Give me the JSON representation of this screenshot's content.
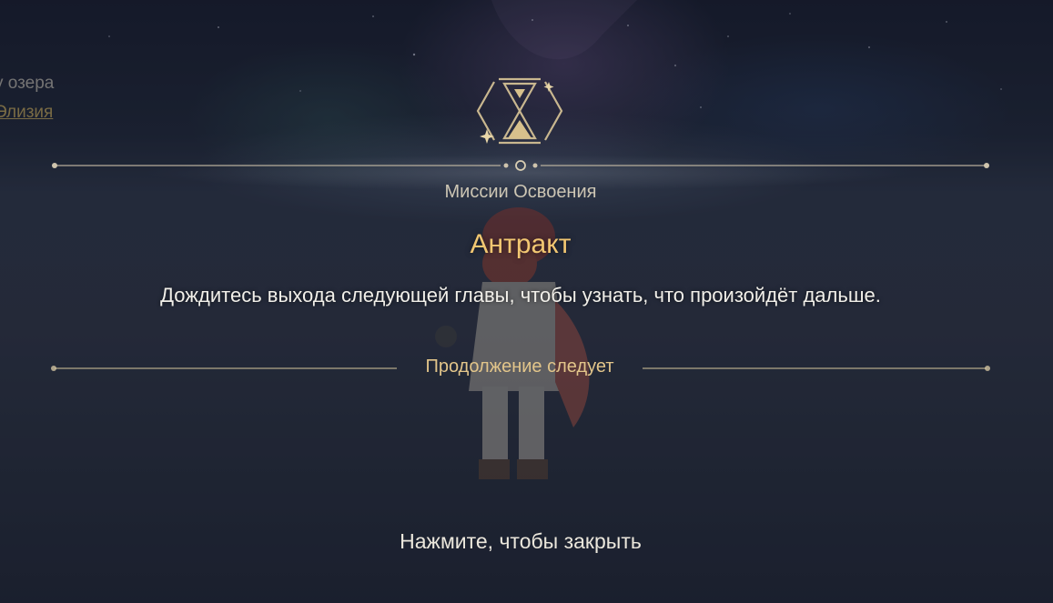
{
  "quest_tracker": {
    "line1": "у озера",
    "line2": "Элизия"
  },
  "dialog": {
    "category": "Миссии Освоения",
    "title": "Антракт",
    "description": "Дождитесь выхода следующей главы, чтобы узнать, что произойдёт дальше.",
    "continue_label": "Продолжение следует",
    "close_hint": "Нажмите, чтобы закрыть"
  },
  "icons": {
    "emblem": "hourglass-emblem-icon"
  },
  "colors": {
    "title": "#f2c772",
    "accent_gold": "#e2c58a",
    "text_light": "#f1efe9",
    "category_text": "#cdc6b4",
    "ornament": "#c9b78f"
  }
}
